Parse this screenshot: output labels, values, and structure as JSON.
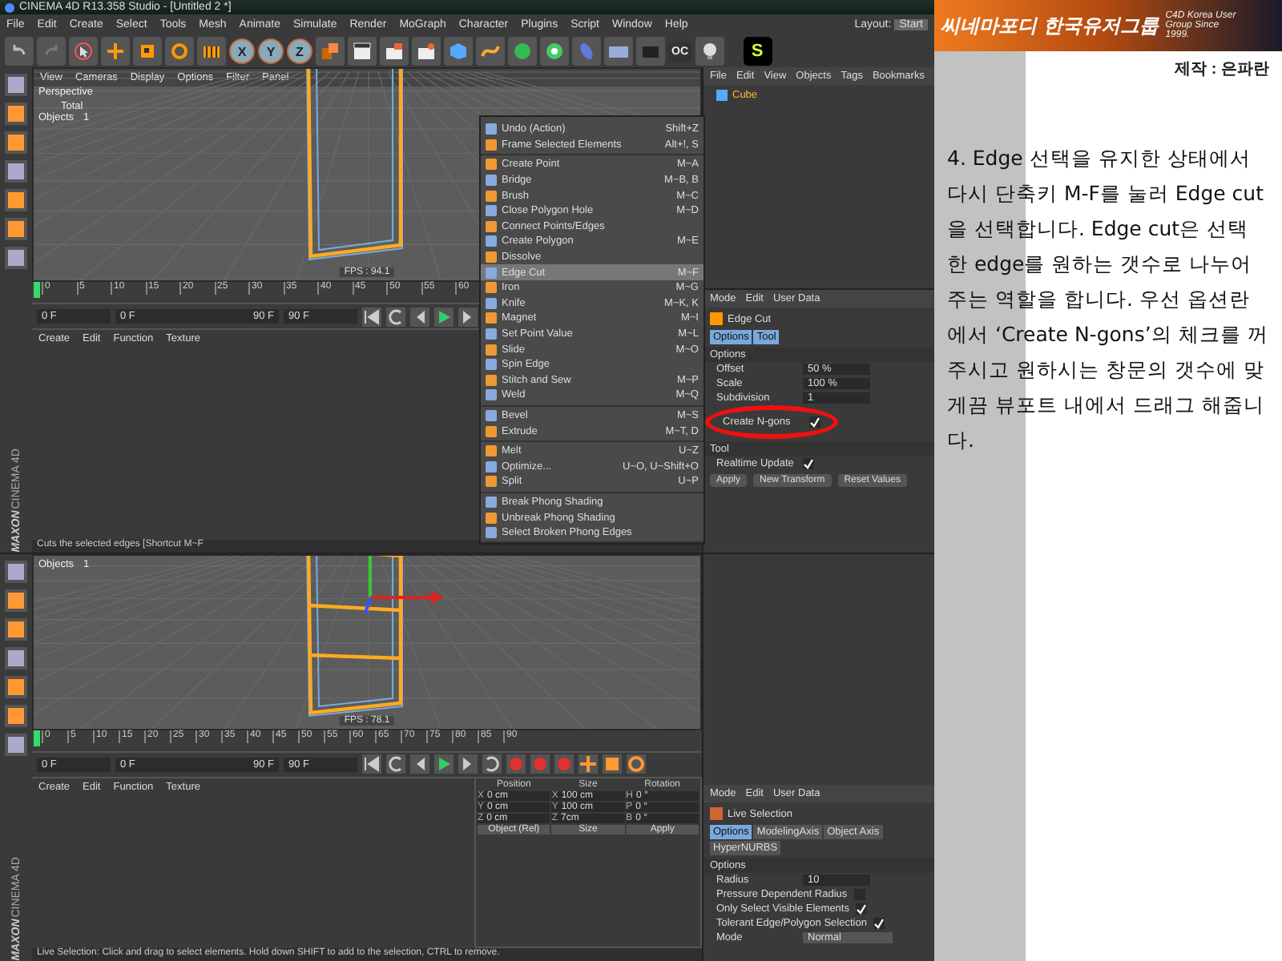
{
  "window": {
    "title": "CINEMA 4D R13.358 Studio - [Untitled 2 *]"
  },
  "menu_bar": {
    "items": [
      "File",
      "Edit",
      "Create",
      "Select",
      "Tools",
      "Mesh",
      "Animate",
      "Simulate",
      "Render",
      "MoGraph",
      "Character",
      "Plugins",
      "Script",
      "Window",
      "Help"
    ],
    "layout_label": "Layout:",
    "layout_value": "Start"
  },
  "toolbar": {
    "axis_buttons": [
      {
        "label": "X",
        "on": true
      },
      {
        "label": "Y",
        "on": true
      },
      {
        "label": "Z",
        "on": true
      }
    ],
    "render_badge": "OC",
    "plugin_badge": "S"
  },
  "top_pane": {
    "brand": [
      "MAXON",
      "CINEMA 4D"
    ],
    "viewport": {
      "menu": [
        "View",
        "Cameras",
        "Display",
        "Options",
        "Filter",
        "Panel"
      ],
      "camera": "Perspective",
      "hud_title": "Total",
      "hud_rows": [
        {
          "label": "Objects",
          "value": "1"
        }
      ],
      "fps": "FPS : 94.1"
    },
    "timeline": {
      "ticks": [
        "0",
        "5",
        "10",
        "15",
        "20",
        "25",
        "30",
        "35",
        "40",
        "45",
        "50",
        "55",
        "60"
      ]
    },
    "frames": {
      "start": "0 F",
      "range_start": "0 F",
      "range_end": "90 F",
      "end": "90 F"
    },
    "material_menu": [
      "Create",
      "Edit",
      "Function",
      "Texture"
    ],
    "status": "Cuts the selected edges [Shortcut M~F",
    "object_manager": {
      "menu": [
        "File",
        "Edit",
        "View",
        "Objects",
        "Tags",
        "Bookmarks"
      ],
      "objects": [
        {
          "name": "Cube"
        }
      ]
    },
    "attributes": {
      "menu": [
        "Mode",
        "Edit",
        "User Data"
      ],
      "title": "Edge Cut",
      "tabs": [
        {
          "label": "Options",
          "selected": true
        },
        {
          "label": "Tool",
          "selected": true
        }
      ],
      "sections": [
        {
          "title": "Options",
          "rows": [
            {
              "kind": "field",
              "label": "Offset",
              "value": "50 %"
            },
            {
              "kind": "field",
              "label": "Scale",
              "value": "100 %"
            },
            {
              "kind": "field",
              "label": "Subdivision",
              "value": "1"
            },
            {
              "kind": "check",
              "label": "Create N-gons",
              "checked": true
            }
          ]
        },
        {
          "title": "Tool",
          "rows": [
            {
              "kind": "check",
              "label": "Realtime Update",
              "checked": true
            }
          ]
        }
      ],
      "buttons": [
        "Apply",
        "New Transform",
        "Reset Values"
      ]
    }
  },
  "bottom_pane": {
    "brand": [
      "MAXON",
      "CINEMA 4D"
    ],
    "viewport": {
      "hud_rows": [
        {
          "label": "Objects",
          "value": "1"
        }
      ],
      "fps": "FPS : 78.1"
    },
    "timeline": {
      "ticks": [
        "0",
        "5",
        "10",
        "15",
        "20",
        "25",
        "30",
        "35",
        "40",
        "45",
        "50",
        "55",
        "60",
        "65",
        "70",
        "75",
        "80",
        "85",
        "90"
      ]
    },
    "frames": {
      "start": "0 F",
      "range_start": "0 F",
      "range_end": "90 F",
      "end": "90 F"
    },
    "material_menu": [
      "Create",
      "Edit",
      "Function",
      "Texture"
    ],
    "coordinates": {
      "headers": [
        "Position",
        "Size",
        "Rotation"
      ],
      "rows": [
        [
          {
            "axis": "X",
            "value": "0 cm"
          },
          {
            "axis": "X",
            "value": "100 cm"
          },
          {
            "axis": "H",
            "value": "0 °"
          }
        ],
        [
          {
            "axis": "Y",
            "value": "0 cm"
          },
          {
            "axis": "Y",
            "value": "100 cm"
          },
          {
            "axis": "P",
            "value": "0 °"
          }
        ],
        [
          {
            "axis": "Z",
            "value": "0 cm"
          },
          {
            "axis": "Z",
            "value": "7cm"
          },
          {
            "axis": "B",
            "value": "0 °"
          }
        ]
      ],
      "mode": "Object (Rel)",
      "size_mode": "Size",
      "apply": "Apply"
    },
    "status": "Live Selection: Click and drag to select elements. Hold down SHIFT to add to the selection, CTRL to remove.",
    "attributes": {
      "menu": [
        "Mode",
        "Edit",
        "User Data"
      ],
      "title": "Live Selection",
      "tabs": [
        {
          "label": "Options",
          "selected": true
        },
        {
          "label": "ModelingAxis",
          "selected": false
        },
        {
          "label": "Object Axis",
          "selected": false
        },
        {
          "label": "HyperNURBS",
          "selected": false
        }
      ],
      "sections": [
        {
          "title": "Options",
          "rows": [
            {
              "kind": "field",
              "label": "Radius",
              "value": "10"
            },
            {
              "kind": "check",
              "label": "Pressure Dependent Radius",
              "checked": false
            },
            {
              "kind": "check",
              "label": "Only Select Visible Elements",
              "checked": true
            },
            {
              "kind": "check",
              "label": "Tolerant Edge/Polygon Selection",
              "checked": true
            },
            {
              "kind": "select",
              "label": "Mode",
              "value": "Normal"
            }
          ]
        }
      ]
    }
  },
  "context_menu": {
    "groups": [
      [
        {
          "label": "Undo (Action)",
          "shortcut": "Shift+Z",
          "selected": false
        },
        {
          "label": "Frame Selected Elements",
          "shortcut": "Alt+!, S",
          "selected": false
        }
      ],
      [
        {
          "label": "Create Point",
          "shortcut": "M~A",
          "selected": false
        },
        {
          "label": "Bridge",
          "shortcut": "M~B, B",
          "selected": false
        },
        {
          "label": "Brush",
          "shortcut": "M~C",
          "selected": false
        },
        {
          "label": "Close Polygon Hole",
          "shortcut": "M~D",
          "selected": false
        },
        {
          "label": "Connect Points/Edges",
          "selected": false
        },
        {
          "label": "Create Polygon",
          "shortcut": "M~E",
          "selected": false
        },
        {
          "label": "Dissolve",
          "selected": false
        },
        {
          "label": "Edge Cut",
          "shortcut": "M~F",
          "selected": true
        },
        {
          "label": "Iron",
          "shortcut": "M~G",
          "selected": false
        },
        {
          "label": "Knife",
          "shortcut": "M~K, K",
          "selected": false
        },
        {
          "label": "Magnet",
          "shortcut": "M~I",
          "selected": false
        },
        {
          "label": "Set Point Value",
          "shortcut": "M~L",
          "selected": false
        },
        {
          "label": "Slide",
          "shortcut": "M~O",
          "selected": false
        },
        {
          "label": "Spin Edge",
          "selected": false
        },
        {
          "label": "Stitch and Sew",
          "shortcut": "M~P",
          "selected": false
        },
        {
          "label": "Weld",
          "shortcut": "M~Q",
          "selected": false
        }
      ],
      [
        {
          "label": "Bevel",
          "shortcut": "M~S",
          "selected": false
        },
        {
          "label": "Extrude",
          "shortcut": "M~T, D",
          "selected": false
        }
      ],
      [
        {
          "label": "Melt",
          "shortcut": "U~Z",
          "selected": false
        },
        {
          "label": "Optimize...",
          "shortcut": "U~O, U~Shift+O",
          "selected": false
        },
        {
          "label": "Split",
          "shortcut": "U~P",
          "selected": false
        }
      ],
      [
        {
          "label": "Break Phong Shading",
          "selected": false
        },
        {
          "label": "Unbreak Phong Shading",
          "selected": false
        },
        {
          "label": "Select Broken Phong Edges",
          "selected": false
        }
      ]
    ]
  },
  "tutorial": {
    "logo": "씨네마포디 한국유저그룹",
    "tagline": "C4D Korea User Group Since 1999.",
    "credit": "제작 : 은파란",
    "body": "4. Edge 선택을 유지한 상태에서 다시 단축키 M-F를 눌러 Edge cut을 선택합니다. Edge cut은 선택한 edge를 원하는 갯수로 나누어 주는 역할을 합니다. 우선 옵션란에서 ‘Create N-gons’의 체크를 꺼주시고 원하시는 창문의 갯수에 맞게끔 뷰포트 내에서 드래그 해줍니다."
  }
}
